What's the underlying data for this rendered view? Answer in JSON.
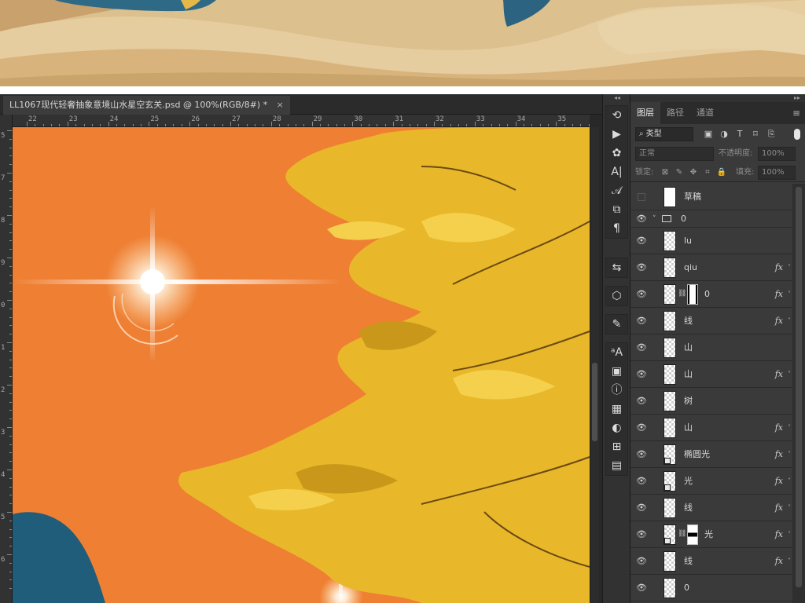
{
  "document": {
    "tab_title": "LL1067现代轻奢抽象意境山水星空玄关.psd @ 100%(RGB/8#) *",
    "close_glyph": "×"
  },
  "rulers": {
    "top": [
      "22",
      "23",
      "24",
      "25",
      "26",
      "27",
      "28",
      "29",
      "30",
      "31",
      "32",
      "33",
      "34",
      "35"
    ],
    "left": [
      "5",
      "7",
      "8",
      "9",
      "0",
      "1",
      "2",
      "3",
      "4",
      "5",
      "6"
    ]
  },
  "canvas": {
    "background": "#ee7f33",
    "tree_color": "#e8b82a",
    "mountain_color": "#1f5d7a"
  },
  "tools": {
    "collapse_glyph": "◂◂",
    "groups": [
      [
        "history-icon",
        "play-icon",
        "brush-settings-icon",
        "character-icon",
        "paragraph-style-icon",
        "clone-source-icon",
        "paragraph-icon"
      ],
      [
        "adjust-icon"
      ],
      [
        "3d-cube-icon"
      ],
      [
        "brush-preset-icon"
      ],
      [
        "glyphs-icon",
        "libraries-icon",
        "info-icon",
        "swatches-grid-icon",
        "color-icon",
        "navigator-icon",
        "notes-icon"
      ]
    ],
    "glyphs": {
      "history-icon": "⟲",
      "play-icon": "▶",
      "brush-settings-icon": "✿",
      "character-icon": "A|",
      "paragraph-style-icon": "𝒜",
      "clone-source-icon": "⧉",
      "paragraph-icon": "¶",
      "adjust-icon": "⇆",
      "3d-cube-icon": "⬡",
      "brush-preset-icon": "✎",
      "glyphs-icon": "ᵃA",
      "libraries-icon": "▣",
      "info-icon": "ⓘ",
      "swatches-grid-icon": "▦",
      "color-icon": "◐",
      "navigator-icon": "⊞",
      "notes-icon": "▤"
    }
  },
  "panel": {
    "collapse_glyph": "▸▸",
    "tabs": [
      "图层",
      "路径",
      "通道"
    ],
    "active_tab": 0,
    "menu_glyph": "≡",
    "filter": {
      "kind_label": "⌕ 类型",
      "buttons": [
        "▣",
        "◑",
        "T",
        "⌑",
        "⎘"
      ]
    },
    "blend_mode": "正常",
    "opacity_label": "不透明度:",
    "opacity_value": "100%",
    "lock_label": "锁定:",
    "lock_buttons": [
      "⊠",
      "✎",
      "✥",
      "⌗",
      "🔒"
    ],
    "fill_label": "填充:",
    "fill_value": "100%",
    "layers": [
      {
        "name": "草稿",
        "visible": false,
        "fx": false,
        "type": "layer"
      },
      {
        "name": "0",
        "visible": true,
        "fx": false,
        "type": "group"
      },
      {
        "name": "lu",
        "visible": true,
        "fx": false,
        "type": "layer"
      },
      {
        "name": "qiu",
        "visible": true,
        "fx": true,
        "type": "layer"
      },
      {
        "name": "0",
        "visible": true,
        "fx": true,
        "type": "masked"
      },
      {
        "name": "线",
        "visible": true,
        "fx": true,
        "type": "layer"
      },
      {
        "name": "山",
        "visible": true,
        "fx": false,
        "type": "layer"
      },
      {
        "name": "山",
        "visible": true,
        "fx": true,
        "type": "layer"
      },
      {
        "name": "树",
        "visible": true,
        "fx": false,
        "type": "layer"
      },
      {
        "name": "山",
        "visible": true,
        "fx": true,
        "type": "layer"
      },
      {
        "name": "椭圆光",
        "visible": true,
        "fx": true,
        "type": "smart"
      },
      {
        "name": "光",
        "visible": true,
        "fx": true,
        "type": "smart"
      },
      {
        "name": "线",
        "visible": true,
        "fx": true,
        "type": "layer"
      },
      {
        "name": "光",
        "visible": true,
        "fx": true,
        "type": "smart-masked"
      },
      {
        "name": "线",
        "visible": true,
        "fx": true,
        "type": "layer"
      },
      {
        "name": "0",
        "visible": true,
        "fx": false,
        "type": "layer"
      }
    ],
    "fx_label": "fx",
    "eye_glyph": "👁",
    "link_glyph": "⛓",
    "chevron_glyph": "˅"
  }
}
